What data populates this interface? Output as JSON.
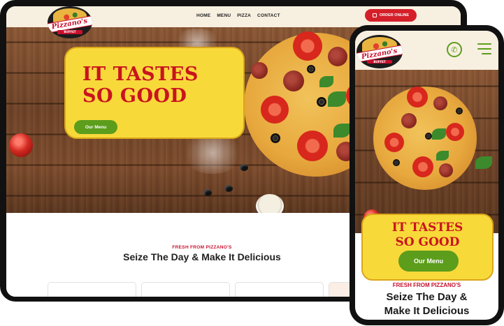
{
  "desktop": {
    "logo": {
      "name": "Pizzano's",
      "sub": "BUFFET"
    },
    "nav": [
      "HOME",
      "MENU",
      "PIZZA",
      "CONTACT"
    ],
    "order_button": "ORDER ONLINE",
    "hero": {
      "title_line1": "IT TASTES",
      "title_line2": "SO GOOD",
      "cta": "Our Menu"
    },
    "section": {
      "kicker": "FRESH FROM PIZZANO'S",
      "heading": "Seize The Day & Make It Delicious"
    }
  },
  "mobile": {
    "logo": {
      "name": "Pizzano's",
      "sub": "BUFFET"
    },
    "hero": {
      "title_line1": "IT TASTES",
      "title_line2": "SO GOOD",
      "cta": "Our Menu"
    },
    "section": {
      "kicker": "FRESH FROM PIZZANO'S",
      "heading_line1": "Seize The Day &",
      "heading_line2": "Make It Delicious"
    }
  },
  "colors": {
    "brand_red": "#c8102e",
    "brand_green": "#5c9d1c",
    "hero_yellow": "#f8d93a",
    "header_cream": "#f7efe0"
  },
  "icons": [
    "phone-icon",
    "hamburger-menu-icon",
    "shopping-bag-icon"
  ]
}
